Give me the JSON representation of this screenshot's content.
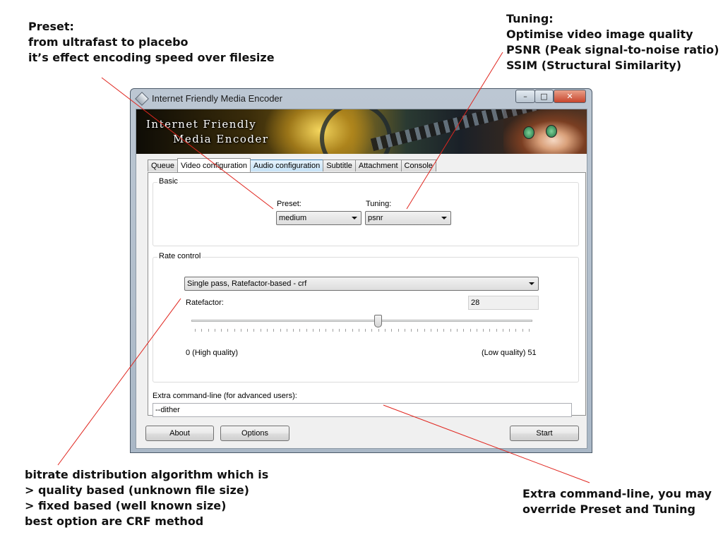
{
  "annotations": {
    "preset": "Preset:\nfrom ultrafast to placebo\nit’s effect encoding speed over filesize",
    "tuning": "Tuning:\nOptimise video image quality\nPSNR (Peak signal-to-noise ratio)\nSSIM (Structural Similarity)",
    "rate_control": "bitrate distribution algorithm which is\n> quality based (unknown file size)\n> fixed based (well known size)\nbest option are CRF method",
    "extra": "Extra command-line, you may\noverride Preset and Tuning"
  },
  "window": {
    "title": "Internet Friendly Media Encoder",
    "minimize": "–",
    "maximize": "□",
    "close": "✕"
  },
  "banner": {
    "logo_line1": "Internet Friendly",
    "logo_line2": "Media Encoder"
  },
  "tabs": [
    {
      "label": "Queue"
    },
    {
      "label": "Video configuration"
    },
    {
      "label": "Audio configuration"
    },
    {
      "label": "Subtitle"
    },
    {
      "label": "Attachment"
    },
    {
      "label": "Console"
    }
  ],
  "active_tab": "Video configuration",
  "basic": {
    "group_title": "Basic",
    "preset_label": "Preset:",
    "preset_value": "medium",
    "tuning_label": "Tuning:",
    "tuning_value": "psnr"
  },
  "rate_control": {
    "group_title": "Rate control",
    "mode_value": "Single pass, Ratefactor-based - crf",
    "ratefactor_label": "Ratefactor:",
    "ratefactor_value": "28",
    "slider_min": 0,
    "slider_max": 51,
    "slider_value": 28,
    "min_label": "0 (High quality)",
    "max_label": "(Low quality) 51"
  },
  "extra": {
    "label": "Extra command-line (for advanced users):",
    "value": "--dither"
  },
  "buttons": {
    "about": "About",
    "options": "Options",
    "start": "Start"
  }
}
